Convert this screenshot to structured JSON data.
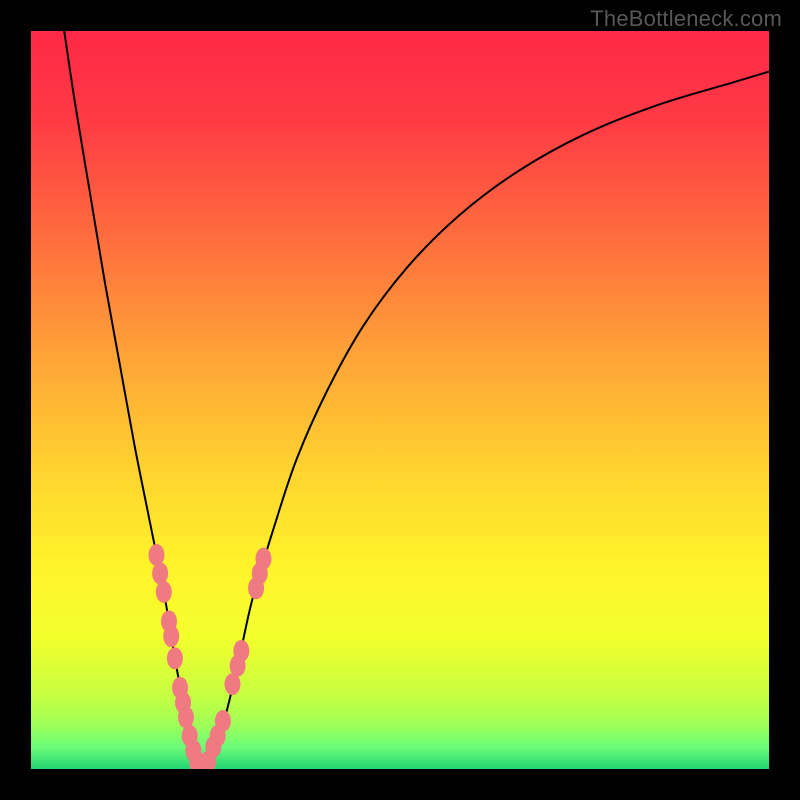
{
  "watermark": "TheBottleneck.com",
  "chart_data": {
    "type": "line",
    "title": "",
    "xlabel": "",
    "ylabel": "",
    "xlim": [
      0,
      100
    ],
    "ylim": [
      0,
      100
    ],
    "grid": false,
    "gradient_stops": [
      {
        "offset": 0.0,
        "color": "#ff2846"
      },
      {
        "offset": 0.12,
        "color": "#ff3a45"
      },
      {
        "offset": 0.28,
        "color": "#ff6d3e"
      },
      {
        "offset": 0.45,
        "color": "#ffa637"
      },
      {
        "offset": 0.6,
        "color": "#ffd52f"
      },
      {
        "offset": 0.73,
        "color": "#fff42a"
      },
      {
        "offset": 0.82,
        "color": "#f4ff2c"
      },
      {
        "offset": 0.9,
        "color": "#c7ff42"
      },
      {
        "offset": 0.94,
        "color": "#9fff58"
      },
      {
        "offset": 0.97,
        "color": "#6cfd78"
      },
      {
        "offset": 1.0,
        "color": "#22d571"
      }
    ],
    "series": [
      {
        "name": "bottleneck-curve",
        "x": [
          4.5,
          6,
          8,
          10,
          12,
          14,
          16,
          18,
          19.5,
          21,
          22,
          23,
          24,
          26,
          28,
          30,
          33,
          36,
          40,
          45,
          51,
          58,
          66,
          75,
          85,
          95,
          100
        ],
        "y": [
          100,
          90,
          78,
          66,
          55,
          44,
          34,
          24,
          15,
          7,
          2,
          0,
          1,
          6,
          14,
          23,
          33,
          42,
          51,
          60,
          68,
          75,
          81,
          86,
          90,
          93,
          94.5
        ]
      }
    ],
    "marker_clusters": [
      {
        "name": "left-branch-markers",
        "color": "#f07a82",
        "points": [
          {
            "x": 17.0,
            "y": 29.0
          },
          {
            "x": 17.5,
            "y": 26.5
          },
          {
            "x": 18.0,
            "y": 24.0
          },
          {
            "x": 18.7,
            "y": 20.0
          },
          {
            "x": 19.0,
            "y": 18.0
          },
          {
            "x": 19.5,
            "y": 15.0
          },
          {
            "x": 20.2,
            "y": 11.0
          },
          {
            "x": 20.6,
            "y": 9.0
          },
          {
            "x": 21.0,
            "y": 7.0
          },
          {
            "x": 21.5,
            "y": 4.5
          },
          {
            "x": 22.0,
            "y": 2.5
          },
          {
            "x": 22.5,
            "y": 1.0
          },
          {
            "x": 23.0,
            "y": 0.0
          }
        ]
      },
      {
        "name": "right-branch-markers",
        "color": "#f07a82",
        "points": [
          {
            "x": 24.0,
            "y": 1.0
          },
          {
            "x": 24.7,
            "y": 3.0
          },
          {
            "x": 25.3,
            "y": 4.5
          },
          {
            "x": 26.0,
            "y": 6.5
          },
          {
            "x": 27.3,
            "y": 11.5
          },
          {
            "x": 28.0,
            "y": 14.0
          },
          {
            "x": 28.5,
            "y": 16.0
          },
          {
            "x": 30.5,
            "y": 24.5
          },
          {
            "x": 31.0,
            "y": 26.5
          },
          {
            "x": 31.5,
            "y": 28.5
          }
        ]
      }
    ]
  }
}
